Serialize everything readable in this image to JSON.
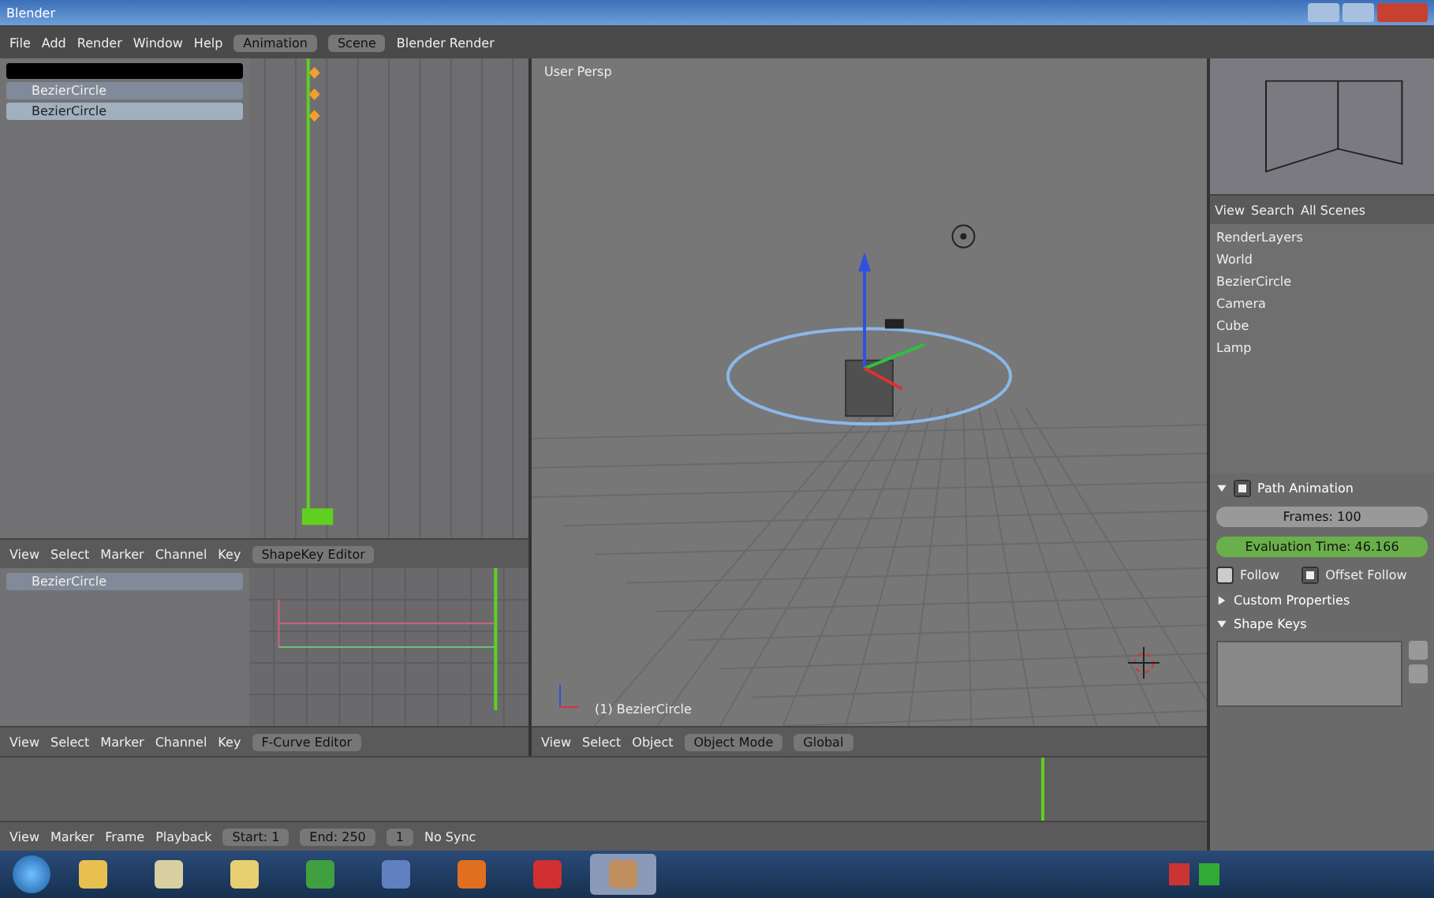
{
  "window": {
    "title": "Blender"
  },
  "info_header": {
    "menus": [
      "File",
      "Add",
      "Render",
      "Window",
      "Help"
    ],
    "screen_layout": "Animation",
    "scene": "Scene",
    "render_engine": "Blender Render"
  },
  "dopesheet": {
    "channels": [
      {
        "name": "BezierCircle",
        "selected": false
      },
      {
        "name": "BezierCircle",
        "selected": true
      }
    ],
    "header": {
      "menus": [
        "View",
        "Select",
        "Marker",
        "Channel",
        "Key"
      ],
      "mode": "ShapeKey Editor"
    }
  },
  "graph_editor": {
    "channels": [
      {
        "name": "BezierCircle",
        "selected": false
      }
    ],
    "header": {
      "menus": [
        "View",
        "Select",
        "Marker",
        "Channel",
        "Key"
      ],
      "mode": "F-Curve Editor"
    }
  },
  "viewport": {
    "view_label": "User Persp",
    "object_label": "(1) BezierCircle",
    "header": {
      "menus": [
        "View",
        "Select",
        "Object"
      ],
      "mode": "Object Mode",
      "orientation": "Global"
    }
  },
  "timeline": {
    "menus": [
      "View",
      "Marker",
      "Frame",
      "Playback"
    ],
    "start": "Start: 1",
    "end": "End: 250",
    "current": "1",
    "sync": "No Sync"
  },
  "outliner": {
    "menus": [
      "View",
      "Search",
      "All Scenes"
    ],
    "items": [
      {
        "name": "RenderLayers"
      },
      {
        "name": "World"
      },
      {
        "name": "BezierCircle"
      },
      {
        "name": "Camera"
      },
      {
        "name": "Cube"
      },
      {
        "name": "Lamp"
      }
    ]
  },
  "properties": {
    "path_animation": {
      "title": "Path Animation",
      "enabled": true,
      "frames": "Frames: 100",
      "evaluation_time": "Evaluation Time: 46.166",
      "options": [
        {
          "label": "Follow",
          "checked": false
        },
        {
          "label": "Offset Follow",
          "checked": true
        }
      ]
    },
    "panels": [
      {
        "title": "Custom Properties",
        "expanded": false
      },
      {
        "title": "Shape Keys",
        "expanded": true
      }
    ]
  }
}
